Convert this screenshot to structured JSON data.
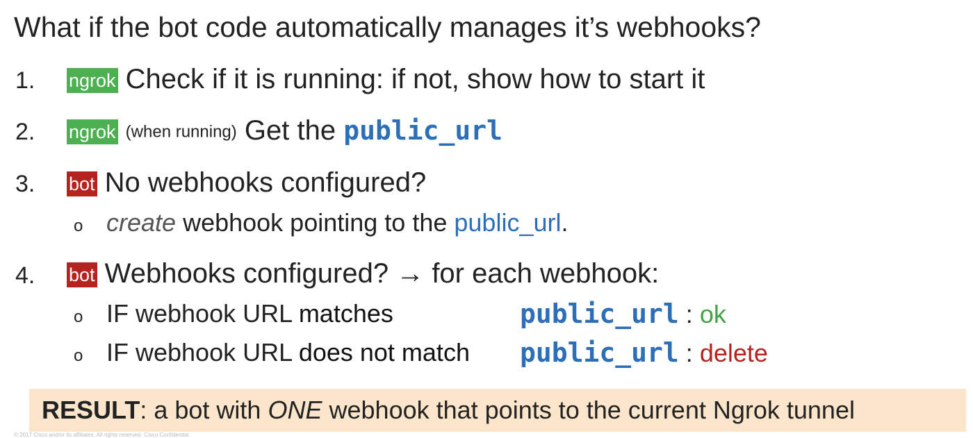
{
  "title": "What if the bot code automatically manages it’s webhooks?",
  "tags": {
    "ngrok": "ngrok",
    "bot": "bot"
  },
  "items": [
    {
      "number": "1.",
      "text": "Check if it is running: if not, show how to start it"
    },
    {
      "number": "2.",
      "note": "(when running)",
      "text": "Get the",
      "code": "public_url"
    },
    {
      "number": "3.",
      "text": "No webhooks configured?",
      "sub": {
        "bullet": "o",
        "emphasis": "create",
        "text": "webhook pointing to the",
        "link": "public_url",
        "end": "."
      }
    },
    {
      "number": "4.",
      "text": "Webhooks configured? → for each webhook:",
      "subs": [
        {
          "bullet": "o",
          "prefix": "IF webhook URL",
          "condition": "matches",
          "code": "public_url",
          "sep": ":",
          "outcome": "ok"
        },
        {
          "bullet": "o",
          "prefix": "IF webhook URL",
          "condition": "does not match",
          "code": "public_url",
          "sep": ":",
          "outcome": "delete"
        }
      ]
    }
  ],
  "result": {
    "label": "RESULT",
    "colon": ":",
    "pre": "a bot with",
    "emphasis": "ONE",
    "post": "webhook that points to the current Ngrok tunnel"
  },
  "footer": "© 2017 Cisco and/or its affiliates. All rights reserved. Cisco Confidential",
  "colors": {
    "ngrok_tag": "#4caf50",
    "bot_tag": "#b5231f",
    "code": "#2c6fb7",
    "ok": "#43a047",
    "delete": "#b5231f",
    "result_bg": "#fbe6cc"
  }
}
